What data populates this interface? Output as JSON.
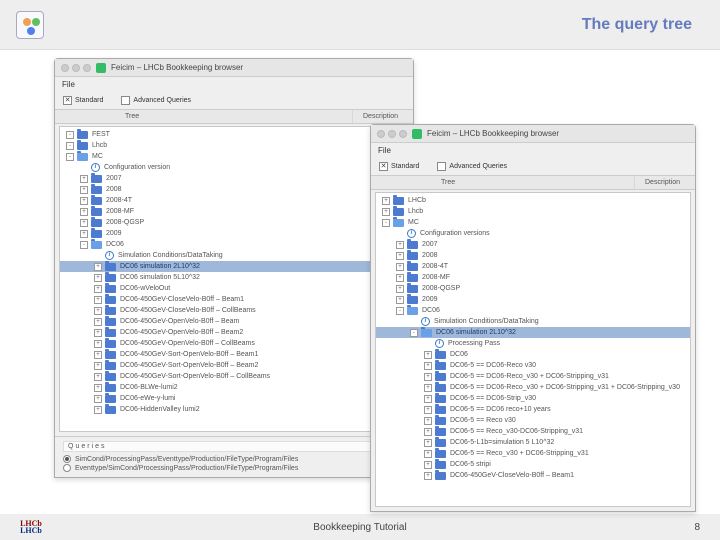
{
  "banner_title": "The query tree",
  "footer": {
    "center": "Bookkeeping Tutorial",
    "page": "8",
    "logo_l1": "LHCb",
    "logo_l2": "LHCb"
  },
  "browser_back": {
    "win_title": "Feicim – LHCb Bookkeeping browser",
    "menu_file": "File",
    "chk_standard": "Standard",
    "chk_advanced": "Advanced Queries",
    "col_tree": "Tree",
    "col_desc": "Description",
    "nodes": [
      {
        "depth": 0,
        "exp": "-",
        "icon": "folder",
        "text": "FEST"
      },
      {
        "depth": 0,
        "exp": "-",
        "icon": "folder",
        "text": "Lhcb"
      },
      {
        "depth": 0,
        "exp": "-",
        "icon": "folder-open",
        "text": "MC"
      },
      {
        "depth": 1,
        "exp": "",
        "icon": "info",
        "text": "Configuration version"
      },
      {
        "depth": 1,
        "exp": "+",
        "icon": "folder",
        "text": "2007"
      },
      {
        "depth": 1,
        "exp": "+",
        "icon": "folder",
        "text": "2008"
      },
      {
        "depth": 1,
        "exp": "+",
        "icon": "folder",
        "text": "2008-4T"
      },
      {
        "depth": 1,
        "exp": "+",
        "icon": "folder",
        "text": "2008-MF"
      },
      {
        "depth": 1,
        "exp": "+",
        "icon": "folder",
        "text": "2008-QGSP"
      },
      {
        "depth": 1,
        "exp": "+",
        "icon": "folder",
        "text": "2009"
      },
      {
        "depth": 1,
        "exp": "-",
        "icon": "folder-open",
        "text": "DC06"
      },
      {
        "depth": 2,
        "exp": "",
        "icon": "info",
        "text": "Simulation Conditions/DataTaking"
      },
      {
        "depth": 2,
        "exp": "+",
        "icon": "folder",
        "text": "DC06 simulation 2L10^32",
        "sel": true
      },
      {
        "depth": 2,
        "exp": "+",
        "icon": "folder",
        "text": "DC06 simulation 5L10^32"
      },
      {
        "depth": 2,
        "exp": "+",
        "icon": "folder",
        "text": "DC06-wVeloOut"
      },
      {
        "depth": 2,
        "exp": "+",
        "icon": "folder",
        "text": "DC06-450GeV-CloseVelo-B0ff – Beam1"
      },
      {
        "depth": 2,
        "exp": "+",
        "icon": "folder",
        "text": "DC06-450GeV-CloseVelo-B0ff – CollBeams"
      },
      {
        "depth": 2,
        "exp": "+",
        "icon": "folder",
        "text": "DC06-450GeV-OpenVelo-B0ff – Beam"
      },
      {
        "depth": 2,
        "exp": "+",
        "icon": "folder",
        "text": "DC06-450GeV-OpenVelo-B0ff – Beam2"
      },
      {
        "depth": 2,
        "exp": "+",
        "icon": "folder",
        "text": "DC06-450GeV-OpenVelo-B0ff – CollBeams"
      },
      {
        "depth": 2,
        "exp": "+",
        "icon": "folder",
        "text": "DC06-450GeV-Sort-OpenVelo-B0ff – Beam1"
      },
      {
        "depth": 2,
        "exp": "+",
        "icon": "folder",
        "text": "DC06-450GeV-Sort-OpenVelo-B0ff – Beam2"
      },
      {
        "depth": 2,
        "exp": "+",
        "icon": "folder",
        "text": "DC06-450GeV-Sort-OpenVelo-B0ff – CollBeams"
      },
      {
        "depth": 2,
        "exp": "+",
        "icon": "folder",
        "text": "DC06-BLWe-lumi2"
      },
      {
        "depth": 2,
        "exp": "+",
        "icon": "folder",
        "text": "DC06-eWe-y-lumi"
      },
      {
        "depth": 2,
        "exp": "+",
        "icon": "folder",
        "text": "DC06-HiddenValley lumi2"
      }
    ],
    "queries_title": "Queries",
    "radio1": "SimCond/ProcessingPass/Eventtype/Production/FileType/Program/Files",
    "radio2": "Eventtype/SimCond/ProcessingPass/Production/FileType/Program/Files"
  },
  "browser_front": {
    "win_title": "Feicim – LHCb Bookkeeping browser",
    "menu_file": "File",
    "chk_standard": "Standard",
    "chk_advanced": "Advanced Queries",
    "col_tree": "Tree",
    "col_desc": "Description",
    "nodes": [
      {
        "depth": 0,
        "exp": "+",
        "icon": "folder",
        "text": "LHCb"
      },
      {
        "depth": 0,
        "exp": "+",
        "icon": "folder",
        "text": "Lhcb"
      },
      {
        "depth": 0,
        "exp": "-",
        "icon": "folder-open",
        "text": "MC"
      },
      {
        "depth": 1,
        "exp": "",
        "icon": "info",
        "text": "Configuration versions"
      },
      {
        "depth": 1,
        "exp": "+",
        "icon": "folder",
        "text": "2007"
      },
      {
        "depth": 1,
        "exp": "+",
        "icon": "folder",
        "text": "2008"
      },
      {
        "depth": 1,
        "exp": "+",
        "icon": "folder",
        "text": "2008-4T"
      },
      {
        "depth": 1,
        "exp": "+",
        "icon": "folder",
        "text": "2008-MF"
      },
      {
        "depth": 1,
        "exp": "+",
        "icon": "folder",
        "text": "2008-QGSP"
      },
      {
        "depth": 1,
        "exp": "+",
        "icon": "folder",
        "text": "2009"
      },
      {
        "depth": 1,
        "exp": "-",
        "icon": "folder-open",
        "text": "DC06"
      },
      {
        "depth": 2,
        "exp": "",
        "icon": "info",
        "text": "Simulation Conditions/DataTaking"
      },
      {
        "depth": 2,
        "exp": "-",
        "icon": "folder-open",
        "text": "DC06 simulation 2L10^32",
        "sel": true
      },
      {
        "depth": 3,
        "exp": "",
        "icon": "info",
        "text": "Processing Pass"
      },
      {
        "depth": 3,
        "exp": "+",
        "icon": "folder",
        "text": "DC06"
      },
      {
        "depth": 3,
        "exp": "+",
        "icon": "folder",
        "text": "DC06-5 == DC06-Reco v30"
      },
      {
        "depth": 3,
        "exp": "+",
        "icon": "folder",
        "text": "DC06-5 == DC06-Reco_v30 + DC06-Stripping_v31"
      },
      {
        "depth": 3,
        "exp": "+",
        "icon": "folder",
        "text": "DC06-5 == DC06-Reco_v30 + DC06-Stripping_v31 + DC06-Stripping_v30"
      },
      {
        "depth": 3,
        "exp": "+",
        "icon": "folder",
        "text": "DC06-5 == DC06-Strip_v30"
      },
      {
        "depth": 3,
        "exp": "+",
        "icon": "folder",
        "text": "DC06-5 == DC06 reco+10 years"
      },
      {
        "depth": 3,
        "exp": "+",
        "icon": "folder",
        "text": "DC06-5 == Reco v30"
      },
      {
        "depth": 3,
        "exp": "+",
        "icon": "folder",
        "text": "DC06-5 == Reco_v30-DC06-Stripping_v31"
      },
      {
        "depth": 3,
        "exp": "+",
        "icon": "folder",
        "text": "DC06-5-L1b=simulation 5 L10^32"
      },
      {
        "depth": 3,
        "exp": "+",
        "icon": "folder",
        "text": "DC06-5 == Reco_v30 + DC06-Stripping_v31"
      },
      {
        "depth": 3,
        "exp": "+",
        "icon": "folder",
        "text": "DC06-5 stripi"
      },
      {
        "depth": 3,
        "exp": "+",
        "icon": "folder",
        "text": "DC06-450GeV-CloseVelo-B0ff – Beam1"
      }
    ]
  }
}
